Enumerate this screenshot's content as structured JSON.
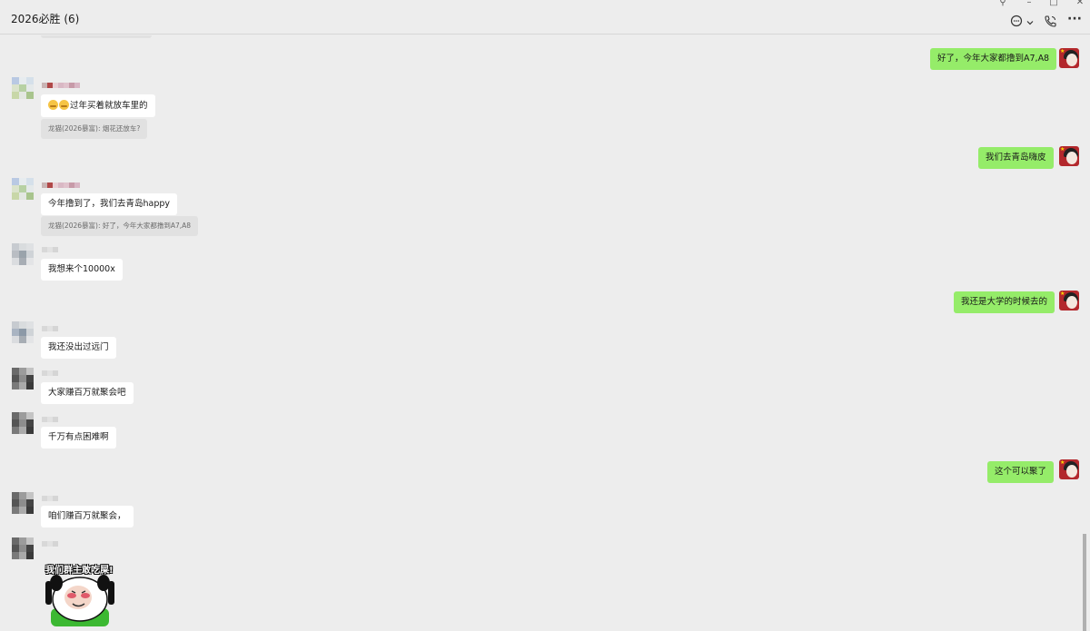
{
  "window": {
    "title": "2026必胜 (6)",
    "controls": {
      "pin": "⚲",
      "minimize": "–",
      "maximize": "□",
      "close": "✕"
    }
  },
  "toolbar": {
    "chat_icon": "chat-bubble-icon",
    "dropdown_icon": "chevron-down-icon",
    "call_icon": "phone-call-icon",
    "more_label": "···"
  },
  "colors": {
    "background": "#ededed",
    "bubble_other": "#ffffff",
    "bubble_self": "#95ec69",
    "quote_bg": "#e1e1e1",
    "quote_text": "#6b6b6b"
  },
  "messages": [
    {
      "side": "right",
      "text": "好了，今年大家都撸到A7,A8"
    },
    {
      "side": "left",
      "text": "过年买着就放车里的",
      "emoji_prefix": "grimacing-emoji",
      "quote": "龙猫(2026暴富): 烟花还放车?"
    },
    {
      "side": "right",
      "text": "我们去青岛嗨皮"
    },
    {
      "side": "left",
      "text": "今年撸到了，我们去青岛happy",
      "quote": "龙猫(2026暴富): 好了，今年大家都撸到A7,A8"
    },
    {
      "side": "left",
      "text": "我想来个10000x"
    },
    {
      "side": "right",
      "text": "我还是大学的时候去的"
    },
    {
      "side": "left",
      "text": "我还没出过远门"
    },
    {
      "side": "left",
      "text": "大家赚百万就聚会吧"
    },
    {
      "side": "left",
      "text": "千万有点困难啊"
    },
    {
      "side": "right",
      "text": "这个可以聚了"
    },
    {
      "side": "left",
      "text": "咱们赚百万就聚会，"
    },
    {
      "side": "left",
      "sticker": true,
      "sticker_text": "我们群主敢吃屎!"
    }
  ]
}
